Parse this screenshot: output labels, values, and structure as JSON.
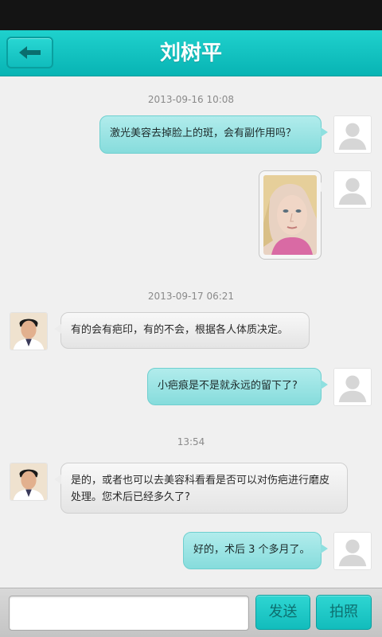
{
  "header": {
    "title": "刘树平",
    "back_icon": "back-arrow-icon"
  },
  "colors": {
    "header_bg": "#0fbdbd",
    "sent_bubble": "#9fe3e3",
    "received_bubble": "#eeeeee",
    "status_bar": "#141414"
  },
  "chat": {
    "timestamps": [
      "2013-09-16 10:08",
      "2013-09-17 06:21",
      "13:54"
    ],
    "messages": [
      {
        "side": "right",
        "type": "text",
        "text": "激光美容去掉脸上的斑，会有副作用吗？"
      },
      {
        "side": "right",
        "type": "image",
        "image": "face-photo"
      },
      {
        "side": "left",
        "type": "text",
        "text": "有的会有疤印，有的不会，根据各人体质决定。"
      },
      {
        "side": "right",
        "type": "text",
        "text": "小疤痕是不是就永远的留下了?"
      },
      {
        "side": "left",
        "type": "text",
        "text": "是的，或者也可以去美容科看看是否可以对伤疤进行磨皮处理。您术后已经多久了?"
      },
      {
        "side": "right",
        "type": "text",
        "text": "好的，术后 3 个多月了。"
      }
    ]
  },
  "input_bar": {
    "input_value": "",
    "input_placeholder": "",
    "send_label": "发送",
    "photo_label": "拍照"
  }
}
